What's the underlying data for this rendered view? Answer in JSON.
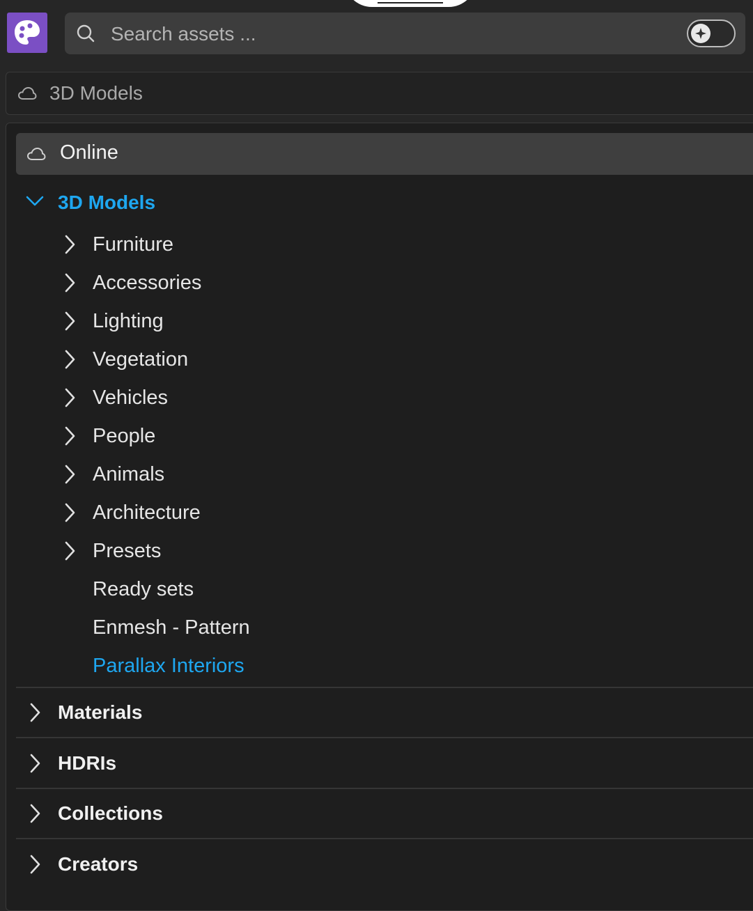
{
  "search": {
    "placeholder": "Search assets ..."
  },
  "breadcrumb": {
    "label": "3D Models"
  },
  "tree": {
    "online_label": "Online",
    "expanded_section": "3D Models",
    "subcategories": [
      "Furniture",
      "Accessories",
      "Lighting",
      "Vegetation",
      "Vehicles",
      "People",
      "Animals",
      "Architecture",
      "Presets"
    ],
    "leaf_items": [
      "Ready sets",
      "Enmesh - Pattern"
    ],
    "active_item": "Parallax Interiors",
    "collapsed_sections": [
      "Materials",
      "HDRIs",
      "Collections",
      "Creators"
    ]
  },
  "colors": {
    "accent_blue": "#1ea7f0",
    "brand_purple": "#7b4fc4",
    "background": "#1e1e1e"
  },
  "icons": {
    "logo": "palette-icon",
    "search": "search-icon",
    "toggle": "sparkle-icon",
    "cloud": "cloud-icon",
    "expand": "chevron-down-icon",
    "collapse": "chevron-right-icon"
  }
}
